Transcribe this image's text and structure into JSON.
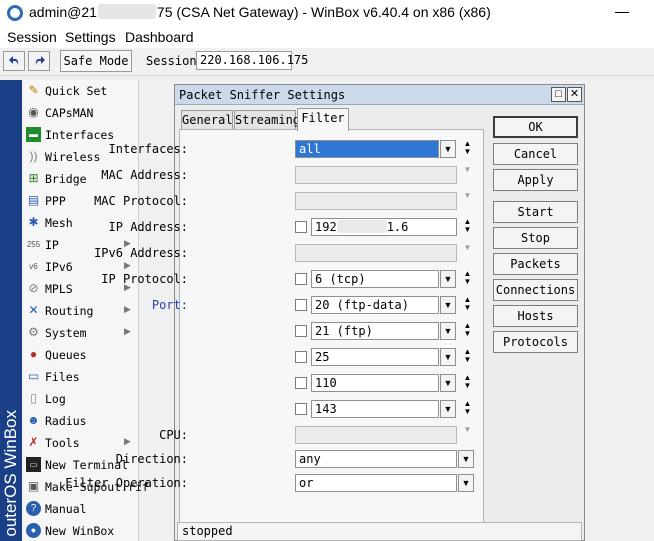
{
  "window": {
    "title_prefix": "admin@21",
    "title_suffix": "75 (CSA Net Gateway) - WinBox v6.40.4 on x86 (x86)"
  },
  "menu": [
    "Session",
    "Settings",
    "Dashboard"
  ],
  "toolbar": {
    "safe_mode": "Safe Mode",
    "session_label": "Session:",
    "session_value": "220.168.106.175"
  },
  "sidebar": {
    "brand": "outerOS WinBox",
    "items": [
      {
        "label": "Quick Set",
        "icon": "quick-set-icon"
      },
      {
        "label": "CAPsMAN",
        "icon": "capsman-icon"
      },
      {
        "label": "Interfaces",
        "icon": "interfaces-icon"
      },
      {
        "label": "Wireless",
        "icon": "wireless-icon"
      },
      {
        "label": "Bridge",
        "icon": "bridge-icon"
      },
      {
        "label": "PPP",
        "icon": "ppp-icon"
      },
      {
        "label": "Mesh",
        "icon": "mesh-icon"
      },
      {
        "label": "IP",
        "icon": "ip-icon",
        "submenu": true
      },
      {
        "label": "IPv6",
        "icon": "ipv6-icon",
        "submenu": true
      },
      {
        "label": "MPLS",
        "icon": "mpls-icon",
        "submenu": true
      },
      {
        "label": "Routing",
        "icon": "routing-icon",
        "submenu": true
      },
      {
        "label": "System",
        "icon": "system-icon",
        "submenu": true
      },
      {
        "label": "Queues",
        "icon": "queues-icon"
      },
      {
        "label": "Files",
        "icon": "files-icon"
      },
      {
        "label": "Log",
        "icon": "log-icon"
      },
      {
        "label": "Radius",
        "icon": "radius-icon"
      },
      {
        "label": "Tools",
        "icon": "tools-icon",
        "submenu": true
      },
      {
        "label": "New Terminal",
        "icon": "terminal-icon"
      },
      {
        "label": "Make Supout.rif",
        "icon": "supout-icon"
      },
      {
        "label": "Manual",
        "icon": "manual-icon"
      },
      {
        "label": "New WinBox",
        "icon": "winbox-icon"
      }
    ]
  },
  "dialog": {
    "title": "Packet Sniffer Settings",
    "tabs": [
      "General",
      "Streaming",
      "Filter"
    ],
    "active_tab": "Filter",
    "fields": {
      "interfaces": {
        "label": "Interfaces:",
        "value": "all"
      },
      "mac_address": {
        "label": "MAC Address:",
        "value": ""
      },
      "mac_protocol": {
        "label": "MAC Protocol:",
        "value": ""
      },
      "ip_address": {
        "label": "IP Address:",
        "value_prefix": "192",
        "value_suffix": "1.6"
      },
      "ipv6_address": {
        "label": "IPv6 Address:",
        "value": ""
      },
      "ip_protocol": {
        "label": "IP Protocol:",
        "value": "6 (tcp)"
      },
      "port": {
        "label": "Port:",
        "values": [
          "20 (ftp-data)",
          "21 (ftp)",
          "25",
          "110",
          "143"
        ]
      },
      "cpu": {
        "label": "CPU:",
        "value": ""
      },
      "direction": {
        "label": "Direction:",
        "value": "any"
      },
      "filter_operation": {
        "label": "Filter Operation:",
        "value": "or"
      }
    },
    "buttons": [
      "OK",
      "Cancel",
      "Apply",
      "Start",
      "Stop",
      "Packets",
      "Connections",
      "Hosts",
      "Protocols"
    ],
    "status": "stopped"
  }
}
